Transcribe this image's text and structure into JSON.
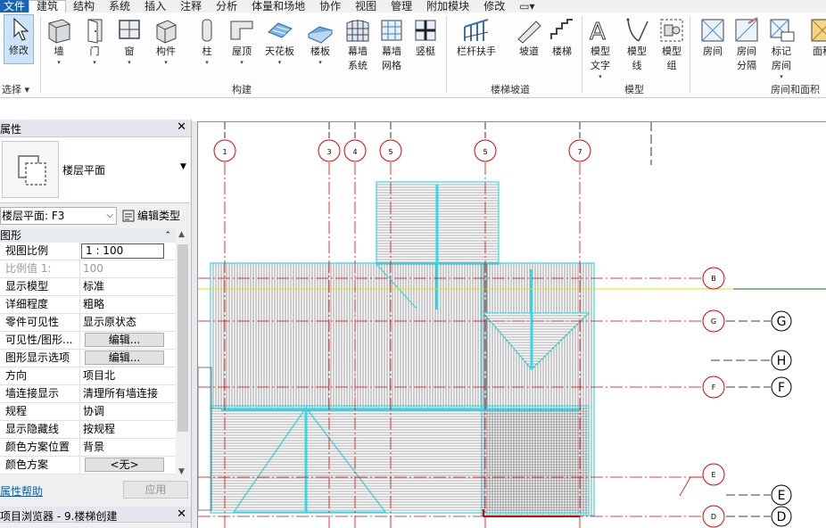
{
  "menu": {
    "file": "文件",
    "tabs": [
      "建筑",
      "结构",
      "系统",
      "插入",
      "注释",
      "分析",
      "体量和场地",
      "协作",
      "视图",
      "管理",
      "附加模块",
      "修改"
    ],
    "active_index": 0,
    "extra_icon": "quick-access-dropdown"
  },
  "ribbon": {
    "buttons": [
      {
        "id": "modify",
        "label": "修改",
        "icon": "cursor-arrow-icon"
      },
      {
        "id": "wall",
        "label": "墙",
        "icon": "wall-icon"
      },
      {
        "id": "door",
        "label": "门",
        "icon": "door-icon"
      },
      {
        "id": "window",
        "label": "窗",
        "icon": "window-icon"
      },
      {
        "id": "component",
        "label": "构件",
        "icon": "component-icon"
      },
      {
        "id": "column",
        "label": "柱",
        "icon": "column-icon"
      },
      {
        "id": "roof",
        "label": "屋顶",
        "icon": "roof-icon"
      },
      {
        "id": "ceiling",
        "label": "天花板",
        "icon": "ceiling-icon"
      },
      {
        "id": "floor",
        "label": "楼板",
        "icon": "floor-icon"
      },
      {
        "id": "curtain-system",
        "label": "幕墙\n系统",
        "icon": "curtain-system-icon"
      },
      {
        "id": "curtain-grid",
        "label": "幕墙\n网格",
        "icon": "curtain-grid-icon"
      },
      {
        "id": "mullion",
        "label": "竖梃",
        "icon": "mullion-icon"
      },
      {
        "id": "railing",
        "label": "栏杆扶手",
        "icon": "railing-icon"
      },
      {
        "id": "ramp",
        "label": "坡道",
        "icon": "ramp-icon"
      },
      {
        "id": "stair",
        "label": "楼梯",
        "icon": "stair-icon"
      },
      {
        "id": "model-text",
        "label": "模型\n文字",
        "icon": "model-text-icon"
      },
      {
        "id": "model-line",
        "label": "模型\n线",
        "icon": "model-line-icon"
      },
      {
        "id": "model-group",
        "label": "模型\n组",
        "icon": "model-group-icon"
      },
      {
        "id": "room",
        "label": "房间",
        "icon": "room-icon"
      },
      {
        "id": "room-separator",
        "label": "房间\n分隔",
        "icon": "room-separator-icon"
      },
      {
        "id": "tag-room",
        "label": "标记\n房间",
        "icon": "tag-room-icon"
      },
      {
        "id": "area",
        "label": "面积",
        "icon": "area-icon"
      }
    ],
    "panels": [
      "选择",
      "构建",
      "楼梯坡道",
      "模型",
      "房间和面积"
    ]
  },
  "properties": {
    "title": "属性",
    "type_name": "楼层平面",
    "selector": "楼层平面: F3",
    "edit_type": "编辑类型",
    "group": "图形",
    "rows": [
      {
        "k": "视图比例",
        "v": "1 : 100",
        "kind": "input"
      },
      {
        "k": "比例值 1:",
        "v": "100",
        "kind": "disabled"
      },
      {
        "k": "显示模型",
        "v": "标准",
        "kind": "text"
      },
      {
        "k": "详细程度",
        "v": "粗略",
        "kind": "text"
      },
      {
        "k": "零件可见性",
        "v": "显示原状态",
        "kind": "text"
      },
      {
        "k": "可见性/图形...",
        "v": "编辑...",
        "kind": "button"
      },
      {
        "k": "图形显示选项",
        "v": "编辑...",
        "kind": "button"
      },
      {
        "k": "方向",
        "v": "项目北",
        "kind": "text"
      },
      {
        "k": "墙连接显示",
        "v": "清理所有墙连接",
        "kind": "text"
      },
      {
        "k": "规程",
        "v": "协调",
        "kind": "text"
      },
      {
        "k": "显示隐藏线",
        "v": "按规程",
        "kind": "text"
      },
      {
        "k": "颜色方案位置",
        "v": "背景",
        "kind": "text"
      },
      {
        "k": "颜色方案",
        "v": "<无>",
        "kind": "button"
      }
    ],
    "help": "属性帮助",
    "apply": "应用"
  },
  "browser": {
    "title": "项目浏览器 - 9.楼梯创建"
  },
  "drawing": {
    "colors": {
      "grid": "#e00000",
      "roof": "#30d8e8",
      "hatch": "#555555",
      "level": "#e8e000",
      "green": "#0a7a0a"
    },
    "vertical_grid_labels": [
      "1",
      "3",
      "4",
      "5",
      "5",
      "7"
    ],
    "right_bubbles_red": [
      "B",
      "G",
      "F",
      "E",
      "D"
    ],
    "right_bubbles_black": [
      "G",
      "H",
      "F",
      "E",
      "D"
    ]
  }
}
